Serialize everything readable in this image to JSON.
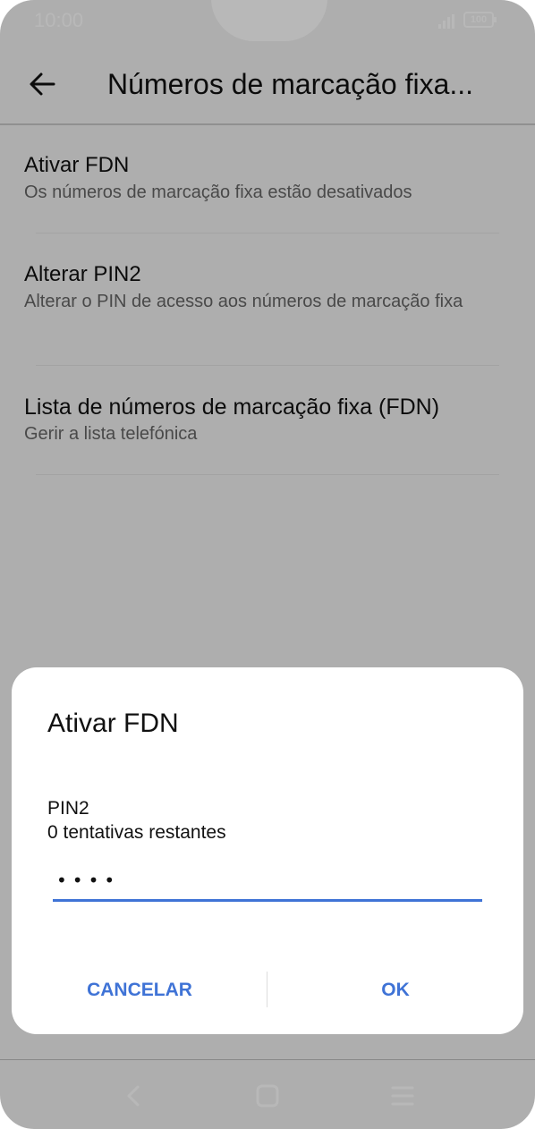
{
  "status_bar": {
    "time": "10:00",
    "battery": "100"
  },
  "app_bar": {
    "title": "Números de marcação fixa..."
  },
  "settings": [
    {
      "title": "Ativar FDN",
      "summary": "Os números de marcação fixa estão desativados"
    },
    {
      "title": "Alterar PIN2",
      "summary": "Alterar o PIN de acesso aos números de marcação fixa"
    },
    {
      "title": "Lista de números de marcação fixa (FDN)",
      "summary": "Gerir a lista telefónica"
    }
  ],
  "dialog": {
    "title": "Ativar FDN",
    "label": "PIN2",
    "attempts": "0 tentativas restantes",
    "pin_value": "••••",
    "cancel_label": "CANCELAR",
    "ok_label": "OK"
  },
  "colors": {
    "accent": "#3f73d6",
    "scrim": "rgba(0,0,0,0.28)"
  },
  "icons": [
    "back-arrow-icon",
    "signal-icon",
    "battery-icon",
    "nav-back-icon",
    "nav-home-icon",
    "nav-menu-icon"
  ]
}
